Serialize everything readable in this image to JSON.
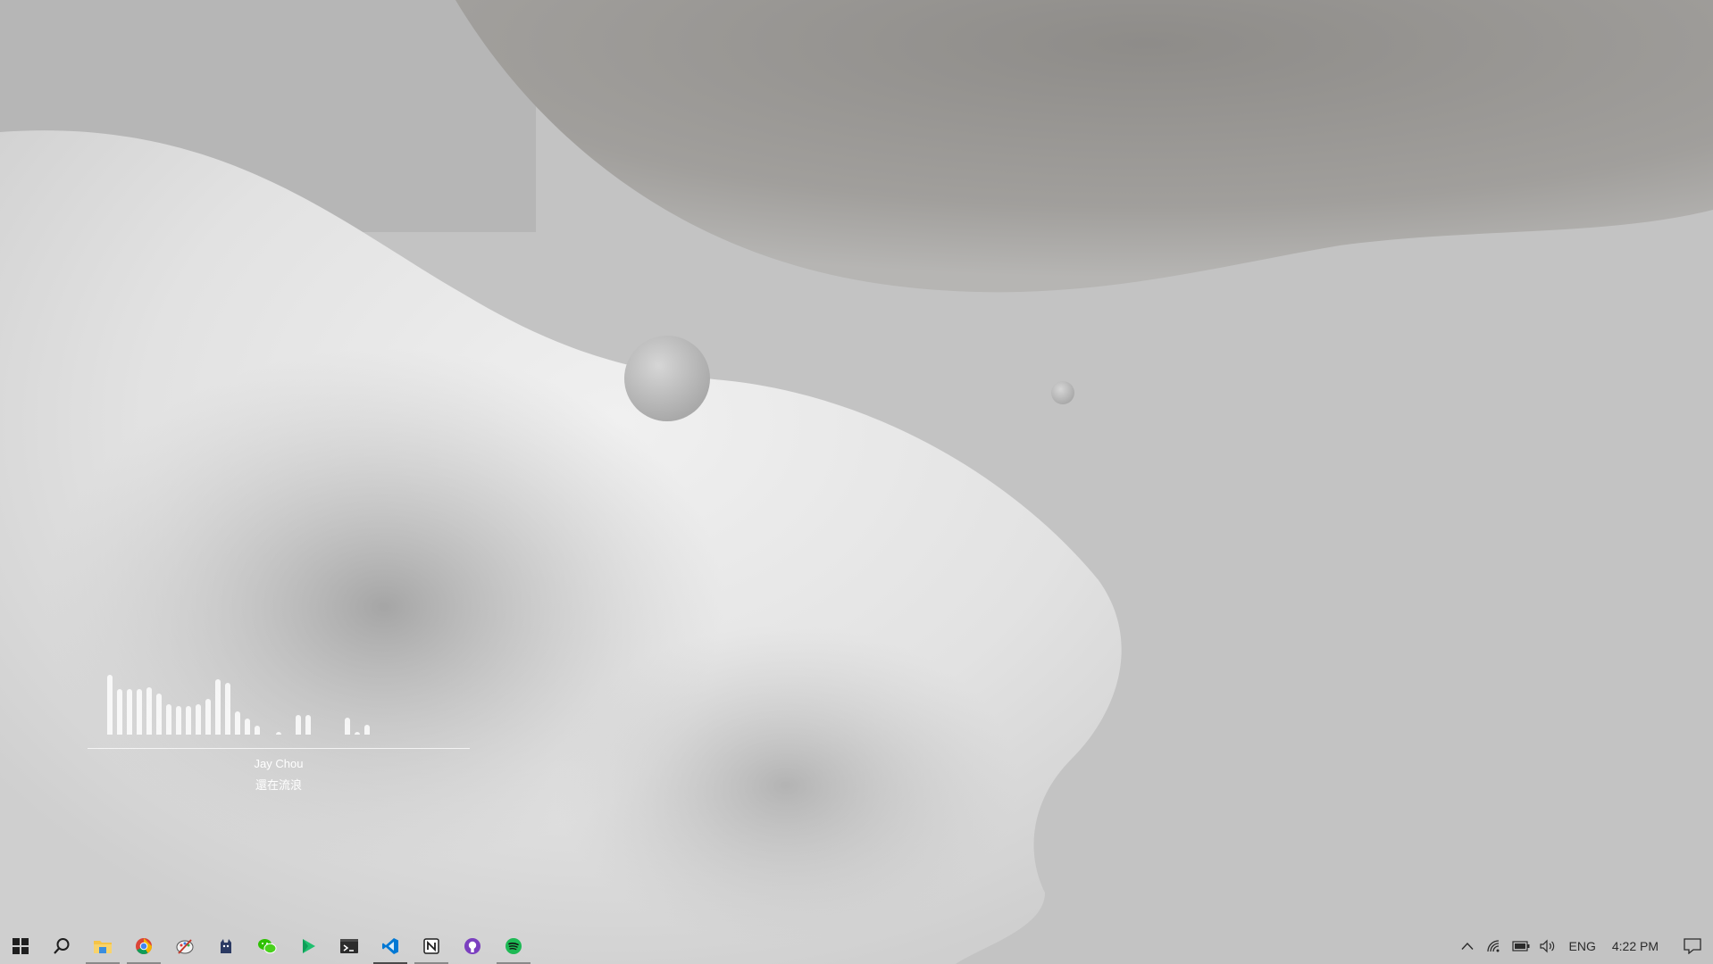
{
  "widget": {
    "artist": "Jay Chou",
    "title": "還在流浪",
    "bar_levels": [
      0.84,
      0.64,
      0.64,
      0.64,
      0.66,
      0.58,
      0.42,
      0.4,
      0.4,
      0.42,
      0.5,
      0.78,
      0.72,
      0.32,
      0.22,
      0.12,
      0,
      0.04,
      0,
      0.28,
      0.28,
      0,
      0,
      0,
      0.24,
      0.04,
      0.14,
      0
    ]
  },
  "taskbar": {
    "apps": [
      {
        "icon": "folder-icon",
        "name": "File Explorer",
        "state": "running"
      },
      {
        "icon": "chrome-icon",
        "name": "Google Chrome",
        "state": "running"
      },
      {
        "icon": "paint-icon",
        "name": "Paint",
        "state": "none"
      },
      {
        "icon": "cat-icon",
        "name": "App",
        "state": "none"
      },
      {
        "icon": "wechat-icon",
        "name": "WeChat",
        "state": "none"
      },
      {
        "icon": "play-icon",
        "name": "Player",
        "state": "none"
      },
      {
        "icon": "terminal-icon",
        "name": "Terminal",
        "state": "none"
      },
      {
        "icon": "vscode-icon",
        "name": "Visual Studio Code",
        "state": "active"
      },
      {
        "icon": "notion-icon",
        "name": "Notion",
        "state": "running"
      },
      {
        "icon": "github-icon",
        "name": "GitHub Desktop",
        "state": "none"
      },
      {
        "icon": "spotify-icon",
        "name": "Spotify",
        "state": "running"
      }
    ],
    "tray": {
      "language": "ENG",
      "time": "4:22 PM"
    }
  },
  "colors": {
    "wifi": "#2b2b2b",
    "chrome_red": "#db4437",
    "chrome_yellow": "#f4b400",
    "chrome_green": "#0f9d58",
    "chrome_blue": "#4285f4",
    "vscode_blue": "#0078d4",
    "spotify_green": "#1db954",
    "github_purple": "#7b3fbf",
    "wechat_green": "#2dc100",
    "folder_yellow": "#f6c445"
  }
}
